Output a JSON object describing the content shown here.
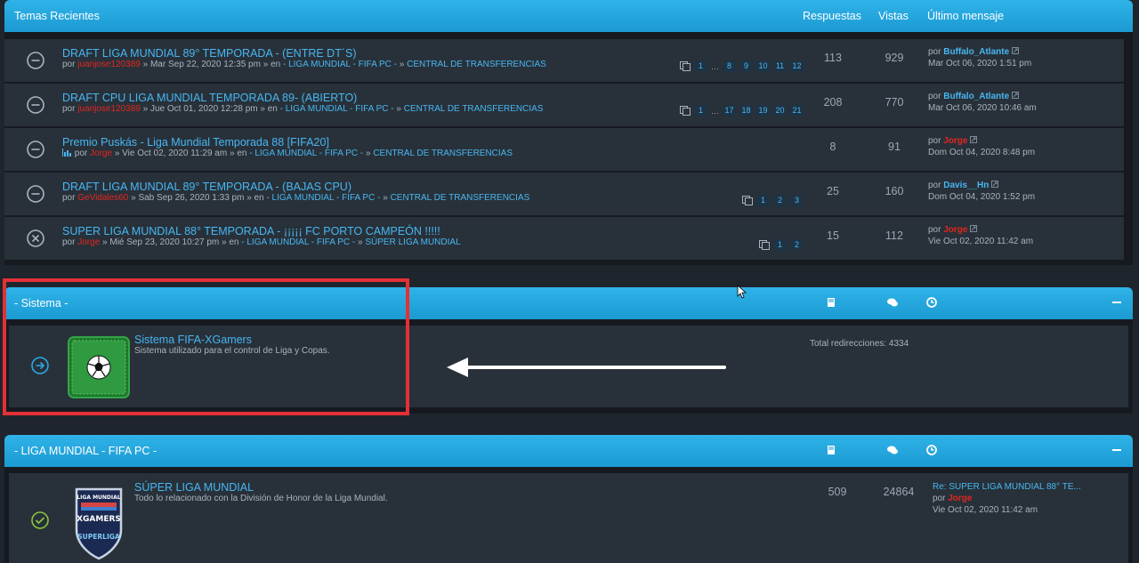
{
  "recent": {
    "header": {
      "title": "Temas Recientes",
      "col_replies": "Respuestas",
      "col_views": "Vistas",
      "col_last": "Último mensaje"
    },
    "topics": [
      {
        "title": "DRAFT LIGA MUNDIAL 89° TEMPORADA - (ENTRE DT´S)",
        "by": "por",
        "author": "juanjose120389",
        "date": "» Mar Sep 22, 2020 12:35 pm » en",
        "forum": "- LIGA MUNDIAL - FIFA PC -",
        "sep": "»",
        "subforum": "CENTRAL DE TRANSFERENCIAS",
        "pages": [
          "1",
          "…",
          "8",
          "9",
          "10",
          "11",
          "12"
        ],
        "replies": "113",
        "views": "929",
        "last_by": "por",
        "last_user": "Buffalo_Atlante",
        "last_date": "Mar Oct 06, 2020 1:51 pm",
        "status": "read"
      },
      {
        "title": "DRAFT CPU LIGA MUNDIAL TEMPORADA 89- (ABIERTO)",
        "by": "por",
        "author": "juanjose120389",
        "date": "» Jue Oct 01, 2020 12:28 pm » en",
        "forum": "- LIGA MUNDIAL - FIFA PC -",
        "sep": "»",
        "subforum": "CENTRAL DE TRANSFERENCIAS",
        "pages": [
          "1",
          "…",
          "17",
          "18",
          "19",
          "20",
          "21"
        ],
        "replies": "208",
        "views": "770",
        "last_by": "por",
        "last_user": "Buffalo_Atlante",
        "last_date": "Mar Oct 06, 2020 10:46 am",
        "status": "read"
      },
      {
        "title": "Premio Puskás - Liga Mundial Temporada 88 [FIFA20]",
        "by": "por",
        "author": "Jorge",
        "date": "» Vie Oct 02, 2020 11:29 am » en",
        "forum": "- LIGA MUNDIAL - FIFA PC -",
        "sep": "»",
        "subforum": "CENTRAL DE TRANSFERENCIAS",
        "pages": [],
        "replies": "8",
        "views": "91",
        "last_by": "por",
        "last_user": "Jorge",
        "last_date": "Dom Oct 04, 2020 8:48 pm",
        "status": "read",
        "poll": true
      },
      {
        "title": "DRAFT LIGA MUNDIAL 89° TEMPORADA - (BAJAS CPU)",
        "by": "por",
        "author": "GeVidales60",
        "date": "» Sab Sep 26, 2020 1:33 pm » en",
        "forum": "- LIGA MUNDIAL - FIFA PC -",
        "sep": "»",
        "subforum": "CENTRAL DE TRANSFERENCIAS",
        "pages": [
          "1",
          "2",
          "3"
        ],
        "replies": "25",
        "views": "160",
        "last_by": "por",
        "last_user": "Davis__Hn",
        "last_date": "Dom Oct 04, 2020 1:52 pm",
        "status": "read"
      },
      {
        "title": "SUPER LIGA MUNDIAL 88° TEMPORADA - ¡¡¡¡¡ FC PORTO CAMPEÓN !!!!!",
        "by": "por",
        "author": "Jorge",
        "date": "» Mié Sep 23, 2020 10:27 pm » en",
        "forum": "- LIGA MUNDIAL - FIFA PC -",
        "sep": "»",
        "subforum": "SÚPER LIGA MUNDIAL",
        "pages": [
          "1",
          "2"
        ],
        "replies": "15",
        "views": "112",
        "last_by": "por",
        "last_user": "Jorge",
        "last_date": "Vie Oct 02, 2020 11:42 am",
        "status": "locked"
      }
    ]
  },
  "sistema": {
    "header": "- Sistema -",
    "forum_title": "Sistema FIFA-XGamers",
    "forum_desc": "Sistema utilizado para el control de Liga y Copas.",
    "redirects": "Total redirecciones: 4334"
  },
  "liga": {
    "header": "- LIGA MUNDIAL - FIFA PC -",
    "forum_title": "SÚPER LIGA MUNDIAL",
    "forum_desc": "Todo lo relacionado con la División de Honor de la Liga Mundial.",
    "topics": "509",
    "posts": "24864",
    "last_title": "Re: SUPER LIGA MUNDIAL 88° TE...",
    "last_by": "por",
    "last_user": "Jorge",
    "last_date": "Vie Oct 02, 2020 11:42 am",
    "logo_text_top": "LIGA MUNDIAL",
    "logo_text_mid": "XGAMERS",
    "logo_text_bottom": "SUPERLIGA"
  },
  "colors": {
    "accent": "#1fa8e0",
    "link": "#48b6f2",
    "user_red": "#e2261f",
    "highlight": "#e33036"
  }
}
